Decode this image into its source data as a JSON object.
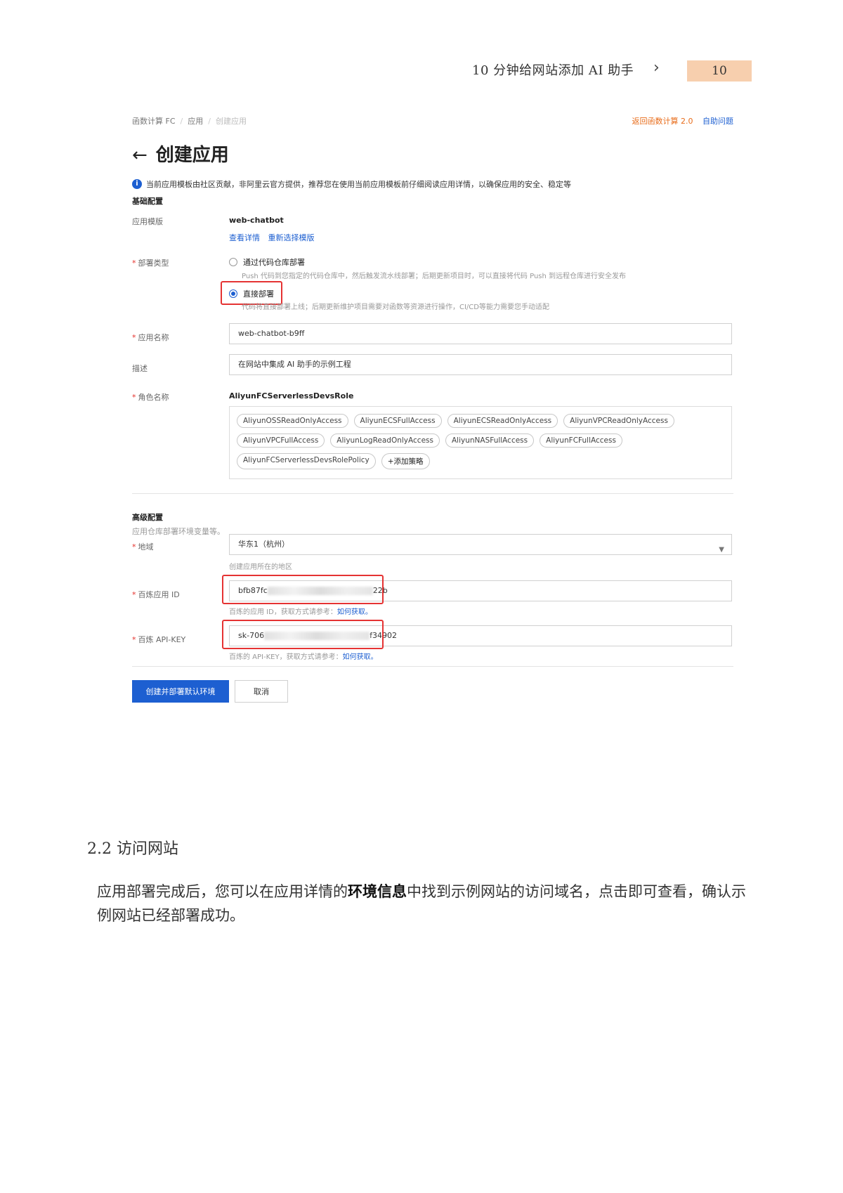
{
  "header": {
    "doc_title": "10 分钟给网站添加 AI 助手",
    "chevron": "›",
    "page_number": "10"
  },
  "console": {
    "breadcrumb": [
      "函数计算 FC",
      "应用",
      "创建应用"
    ],
    "breadcrumb_sep": "/",
    "back_link": "返回函数计算 2.0",
    "help_link": "自助问题",
    "title": "创建应用",
    "back_arrow": "←",
    "notice": "当前应用模板由社区贡献，非阿里云官方提供，推荐您在使用当前应用模板前仔细阅读应用详情，以确保应用的安全、稳定等",
    "basic_section": "基础配置",
    "template_label": "应用模版",
    "template_value": "web-chatbot",
    "view_detail": "查看详情",
    "reselect_template": "重新选择模版",
    "deploy_type_label": "部署类型",
    "deploy_option_repo": "通过代码仓库部署",
    "deploy_option_repo_hint": "Push 代码到您指定的代码仓库中，然后触发流水线部署；后期更新项目时，可以直接将代码 Push 到远程仓库进行安全发布",
    "deploy_option_direct": "直接部署",
    "deploy_option_direct_hint": "代码将直接部署上线；后期更新维护项目需要对函数等资源进行操作，CI/CD等能力需要您手动适配",
    "app_name_label": "应用名称",
    "app_name_value": "web-chatbot-b9ff",
    "desc_label": "描述",
    "desc_value": "在网站中集成 AI 助手的示例工程",
    "role_label": "角色名称",
    "role_value": "AliyunFCServerlessDevsRole",
    "policies": [
      "AliyunOSSReadOnlyAccess",
      "AliyunECSFullAccess",
      "AliyunECSReadOnlyAccess",
      "AliyunVPCReadOnlyAccess",
      "AliyunVPCFullAccess",
      "AliyunLogReadOnlyAccess",
      "AliyunNASFullAccess",
      "AliyunFCFullAccess",
      "AliyunFCServerlessDevsRolePolicy"
    ],
    "add_policy": "+添加策略",
    "advanced_section": "高级配置",
    "advanced_hint": "应用仓库部署环境变量等。",
    "region_label": "地域",
    "region_value": "华东1（杭州）",
    "region_hint": "创建应用所在的地区",
    "bailian_id_label": "百炼应用 ID",
    "bailian_id_prefix": "bfb87fc",
    "bailian_id_suffix": "22b",
    "bailian_id_hint": "百炼的应用 ID，获取方式请参考：",
    "bailian_id_link": "如何获取。",
    "api_key_label": "百炼 API-KEY",
    "api_key_prefix": "sk-706",
    "api_key_suffix": "f34902",
    "api_key_hint": "百炼的 API-KEY，获取方式请参考：",
    "api_key_link": "如何获取。",
    "create_button": "创建并部署默认环境",
    "cancel_button": "取消",
    "required_mark": "*"
  },
  "section": {
    "heading": "2.2 访问网站",
    "para_before": "应用部署完成后，您可以在应用详情的",
    "para_bold": "环境信息",
    "para_after": "中找到示例网站的访问域名，点击即可查看，确认示例网站已经部署成功。"
  },
  "colors": {
    "page_num_bg": "#f7cfae",
    "primary": "#1d5fd1",
    "highlight": "#e53333",
    "orange_link": "#e86c1a"
  }
}
